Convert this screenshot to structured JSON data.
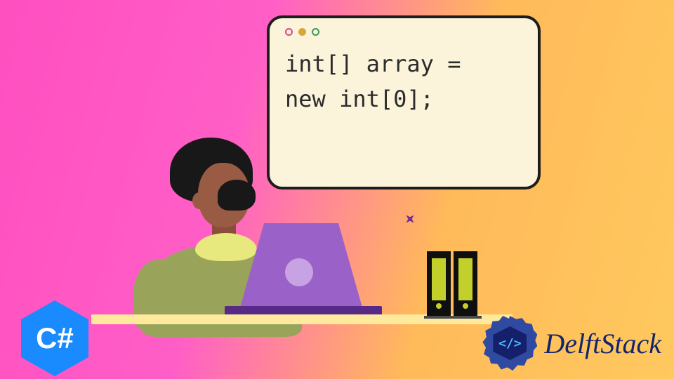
{
  "code_window": {
    "line1": "int[] array =",
    "line2": "new int[0];"
  },
  "csharp_badge": {
    "label": "C#"
  },
  "delftstack": {
    "mark_glyph": "</>",
    "text": "DelftStack"
  }
}
